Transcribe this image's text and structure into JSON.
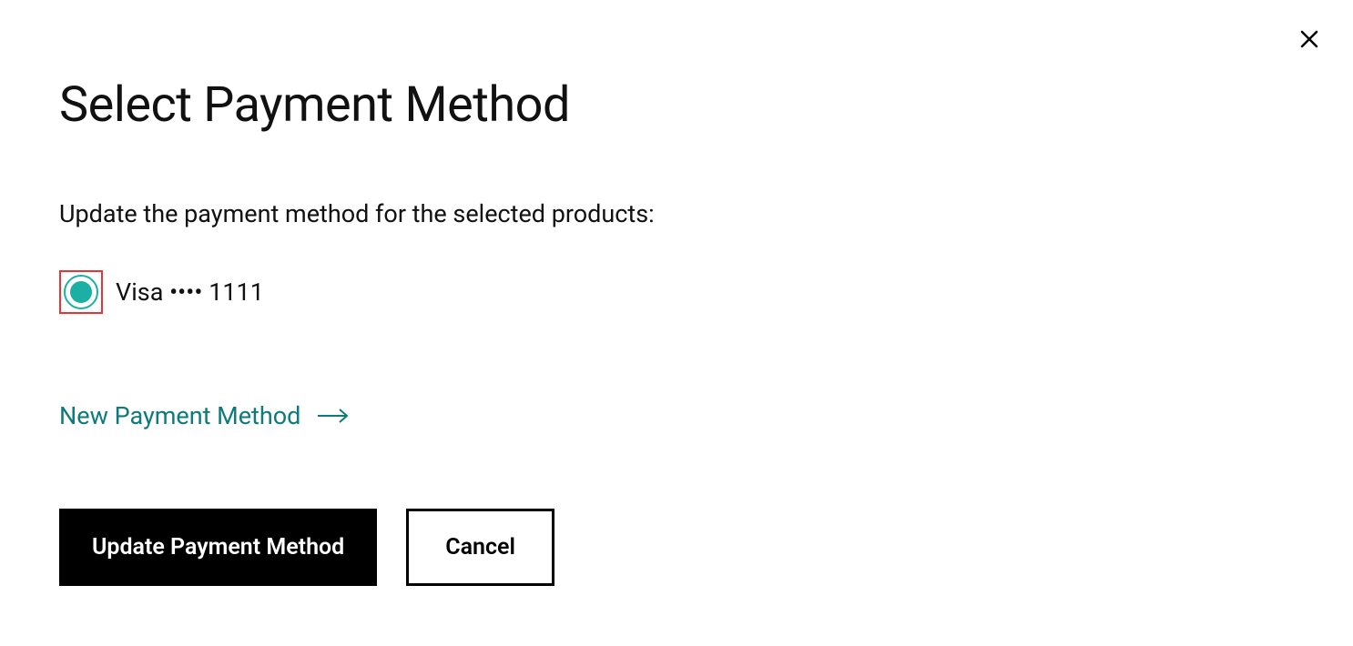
{
  "dialog": {
    "title": "Select Payment Method",
    "description": "Update the payment method for the selected products:",
    "paymentOptions": [
      {
        "label": "Visa •••• 1111",
        "selected": true,
        "highlighted": true
      }
    ],
    "newPaymentLink": "New Payment Method",
    "buttons": {
      "primary": "Update Payment Method",
      "secondary": "Cancel"
    }
  },
  "colors": {
    "accent": "#1bb0a3",
    "linkColor": "#0d7b7b",
    "highlight": "#e73535"
  }
}
